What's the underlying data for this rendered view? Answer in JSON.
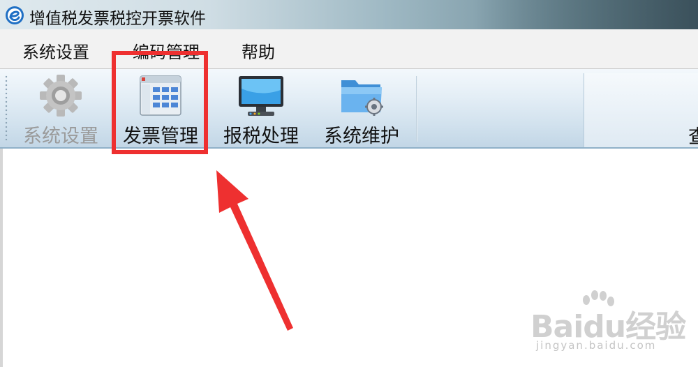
{
  "window": {
    "title": "增值税发票税控开票软件",
    "app_icon": "circular-e-logo-icon"
  },
  "menubar": {
    "items": [
      {
        "label": "系统设置"
      },
      {
        "label": "编码管理"
      },
      {
        "label": "帮助"
      }
    ]
  },
  "toolbar": {
    "buttons": [
      {
        "label": "系统设置",
        "icon": "gear-icon",
        "enabled": false
      },
      {
        "label": "发票管理",
        "icon": "invoice-window-icon",
        "enabled": true
      },
      {
        "label": "报税处理",
        "icon": "monitor-icon",
        "enabled": true
      },
      {
        "label": "系统维护",
        "icon": "folder-gear-icon",
        "enabled": true
      }
    ],
    "truncated_label": "查"
  },
  "annotation": {
    "highlight_color": "#ee3030",
    "highlight_target": "发票管理"
  },
  "watermark": {
    "brand": "Baidu经验",
    "url": "jingyan.baidu.com"
  }
}
